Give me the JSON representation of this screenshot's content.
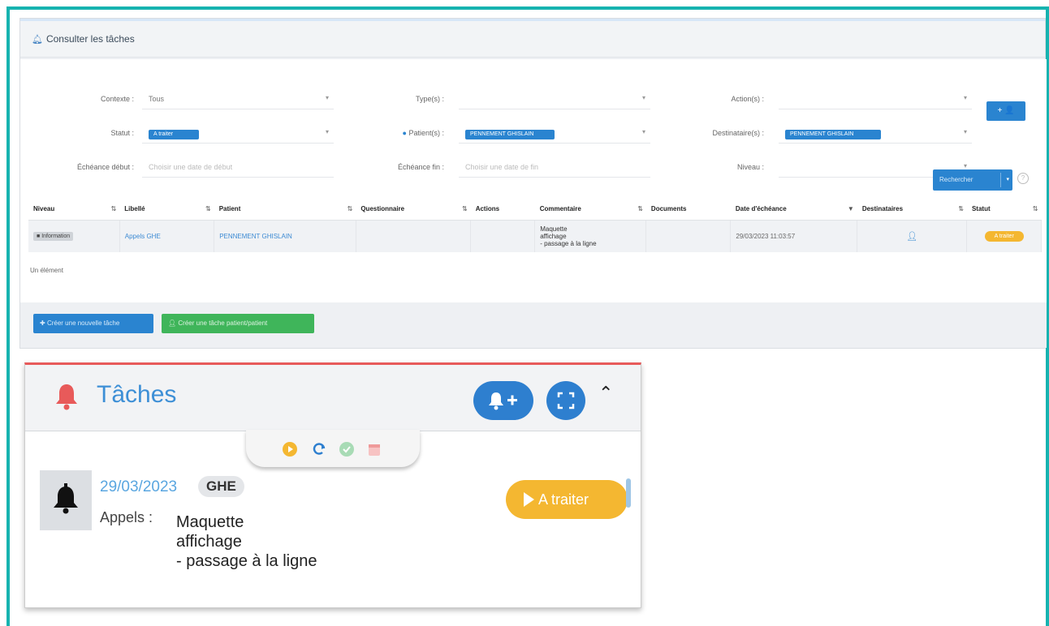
{
  "top_panel": {
    "title": "Consulter les tâches",
    "filters": {
      "contexte_label": "Contexte :",
      "contexte_value": "Tous",
      "types_label": "Type(s) :",
      "actions_label": "Action(s) :",
      "statut_label": "Statut :",
      "statut_tag": "A traiter",
      "patients_label": "Patient(s) :",
      "patients_tag": "PENNEMENT GHISLAIN",
      "destinataires_label": "Destinataire(s) :",
      "destinataires_tag": "PENNEMENT GHISLAIN",
      "echeance_debut_label": "Échéance début :",
      "echeance_debut_placeholder": "Choisir une date de début",
      "echeance_fin_label": "Échéance fin :",
      "echeance_fin_placeholder": "Choisir une date de fin",
      "niveau_label": "Niveau :"
    },
    "add_recipient_label": "+ 👤",
    "search_label": "Rechercher",
    "columns": [
      "Niveau",
      "Libellé",
      "Patient",
      "Questionnaire",
      "Actions",
      "Commentaire",
      "Documents",
      "Date d'échéance",
      "Destinataires",
      "Statut"
    ],
    "row": {
      "niveau": "Information",
      "libelle": "Appels GHE",
      "patient": "PENNEMENT GHISLAIN",
      "commentaire": [
        "Maquette",
        "affichage",
        "- passage à la ligne"
      ],
      "date_echeance": "29/03/2023 11:03:57",
      "statut": "A traiter"
    },
    "count_text": "Un élément",
    "btn_new_task": "Créer une nouvelle tâche",
    "btn_new_patient_task": "Créer une tâche patient/patient"
  },
  "card": {
    "title": "Tâches",
    "task": {
      "date": "29/03/2023",
      "user": "GHE",
      "type": "Appels :",
      "comment_lines": [
        "Maquette",
        "affichage",
        "- passage à la ligne"
      ],
      "status": "A traiter"
    }
  },
  "colors": {
    "frame": "#17b3b0",
    "primary": "#2a84d0",
    "success": "#3fb55a",
    "warning": "#f4b731",
    "danger": "#e85a5a",
    "title_blue": "#3d8fd6"
  }
}
